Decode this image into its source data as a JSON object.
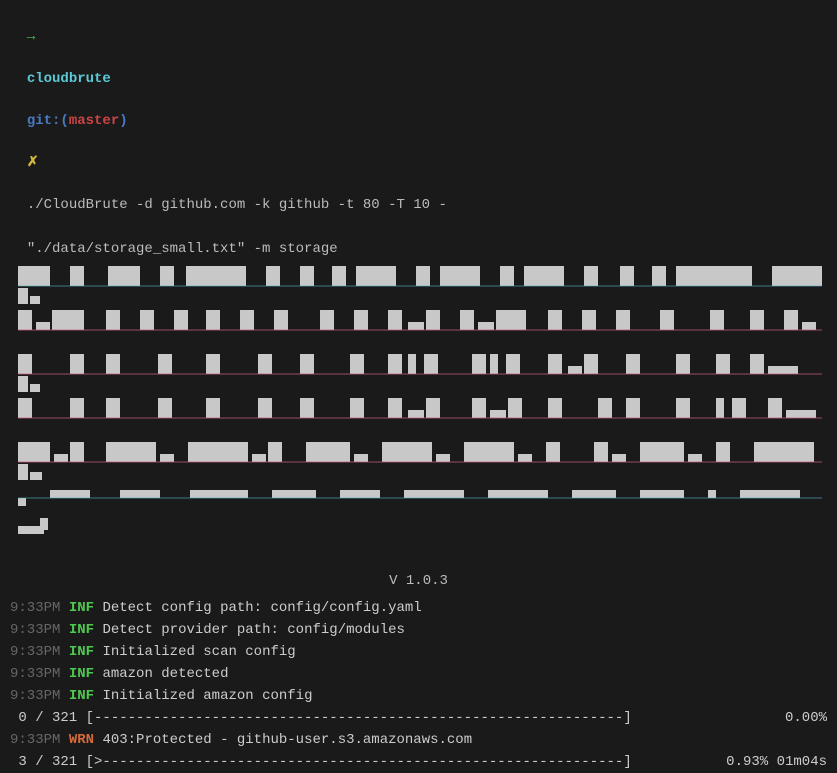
{
  "prompt": {
    "arrow": "→",
    "dir": "cloudbrute",
    "git_label": "git:(",
    "branch": "master",
    "git_close": ")",
    "marker": "✗",
    "command_line1": "./CloudBrute -d github.com -k github -t 80 -T 10 -",
    "command_line2": "\"./data/storage_small.txt\" -m storage"
  },
  "version": "V 1.0.3",
  "logs": [
    {
      "time": "9:33PM",
      "level": "INF",
      "msg": "Detect config path: config/config.yaml"
    },
    {
      "time": "9:33PM",
      "level": "INF",
      "msg": "Detect provider path: config/modules"
    },
    {
      "time": "9:33PM",
      "level": "INF",
      "msg": "Initialized scan config"
    },
    {
      "time": "9:33PM",
      "level": "INF",
      "msg": "amazon detected"
    },
    {
      "time": "9:33PM",
      "level": "INF",
      "msg": "Initialized amazon config"
    }
  ],
  "progress1": {
    "count": " 0 / 321 ",
    "bar": "[---------------------------------------------------------------]",
    "pct": "  0.00%"
  },
  "warn": {
    "time": "9:33PM",
    "level": "WRN",
    "msg": "403:Protected - github-user.s3.amazonaws.com"
  },
  "progress2": {
    "count": " 3 / 321 ",
    "bar": "[>--------------------------------------------------------------]",
    "pct": "  0.93% 01m04s"
  }
}
